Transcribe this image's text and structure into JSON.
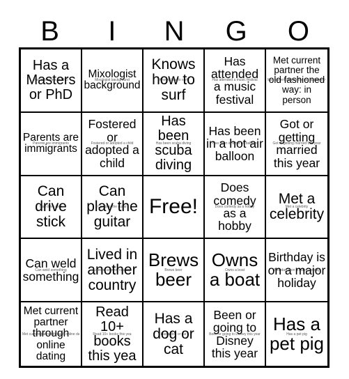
{
  "header": {
    "letters": [
      "B",
      "I",
      "N",
      "G",
      "O"
    ]
  },
  "grid": {
    "rows": 5,
    "columns": 5,
    "border_color": "#000000",
    "background_color": "#ffffff",
    "text_color": "#000000"
  },
  "cells": [
    {
      "id": "b1",
      "text": "Has a Masters or PhD",
      "ghost": "Has a Masters or PhD",
      "size": "fs-20"
    },
    {
      "id": "i1",
      "text": "Mixologist background",
      "ghost": "Mixologist background",
      "size": "fs-16"
    },
    {
      "id": "n1",
      "text": "Knows how to surf",
      "ghost": "Knows how to surf",
      "size": "fs-22"
    },
    {
      "id": "g1",
      "text": "Has attended a music festival",
      "ghost": "Has attended a music festival",
      "size": "fs-18"
    },
    {
      "id": "o1",
      "text": "Met current partner the old fashioned way: in person",
      "ghost": "Met current partner the old fashioned way: in person",
      "size": "fs-14"
    },
    {
      "id": "b2",
      "text": "Parents are immigrants",
      "ghost": "Parents are immigrants",
      "size": "fs-16"
    },
    {
      "id": "i2",
      "text": "Fostered or adopted a child",
      "ghost": "Fostered or adopted a child",
      "size": "fs-18"
    },
    {
      "id": "n2",
      "text": "Has been scuba diving",
      "ghost": "Has been scuba diving",
      "size": "fs-20"
    },
    {
      "id": "g2",
      "text": "Has been in a hot air balloon",
      "ghost": "Has been in a hot air balloon",
      "size": "fs-18"
    },
    {
      "id": "o2",
      "text": "Got or getting married this year",
      "ghost": "Got or getting married this year",
      "size": "fs-18"
    },
    {
      "id": "b3",
      "text": "Can drive stick",
      "ghost": "Can drive stick",
      "size": "fs-22"
    },
    {
      "id": "i3",
      "text": "Can play the guitar",
      "ghost": "Can play the guitar",
      "size": "fs-22"
    },
    {
      "id": "n3",
      "text": "Free!",
      "ghost": "",
      "size": "fs-30"
    },
    {
      "id": "g3",
      "text": "Does comedy as a hobby",
      "ghost": "Does comedy as a hobby",
      "size": "fs-18"
    },
    {
      "id": "o3",
      "text": "Met a celebrity",
      "ghost": "Met a celebrity",
      "size": "fs-22"
    },
    {
      "id": "b4",
      "text": "Can weld something",
      "ghost": "Can weld something",
      "size": "fs-18"
    },
    {
      "id": "i4",
      "text": "Lived in another country",
      "ghost": "Lived in another country",
      "size": "fs-22"
    },
    {
      "id": "n4",
      "text": "Brews beer",
      "ghost": "Brews beer",
      "size": "fs-26"
    },
    {
      "id": "g4",
      "text": "Owns a boat",
      "ghost": "Owns a boat",
      "size": "fs-26"
    },
    {
      "id": "o4",
      "text": "Birthday is on a major holiday",
      "ghost": "Birthday is on a major holiday",
      "size": "fs-18"
    },
    {
      "id": "b5",
      "text": "Met current partner through online dating",
      "ghost": "Met current partner through online dating",
      "size": "fs-16"
    },
    {
      "id": "i5",
      "text": "Read 10+ books this yea",
      "ghost": "Read 10+ books this yea",
      "size": "fs-20"
    },
    {
      "id": "n5",
      "text": "Has a dog or cat",
      "ghost": "Has a dog or cat",
      "size": "fs-22"
    },
    {
      "id": "g5",
      "text": "Been or going to Disney this year",
      "ghost": "Been or going to Disney this year",
      "size": "fs-18"
    },
    {
      "id": "o5",
      "text": "Has a pet pig",
      "ghost": "Has a pet pig",
      "size": "fs-26"
    }
  ]
}
